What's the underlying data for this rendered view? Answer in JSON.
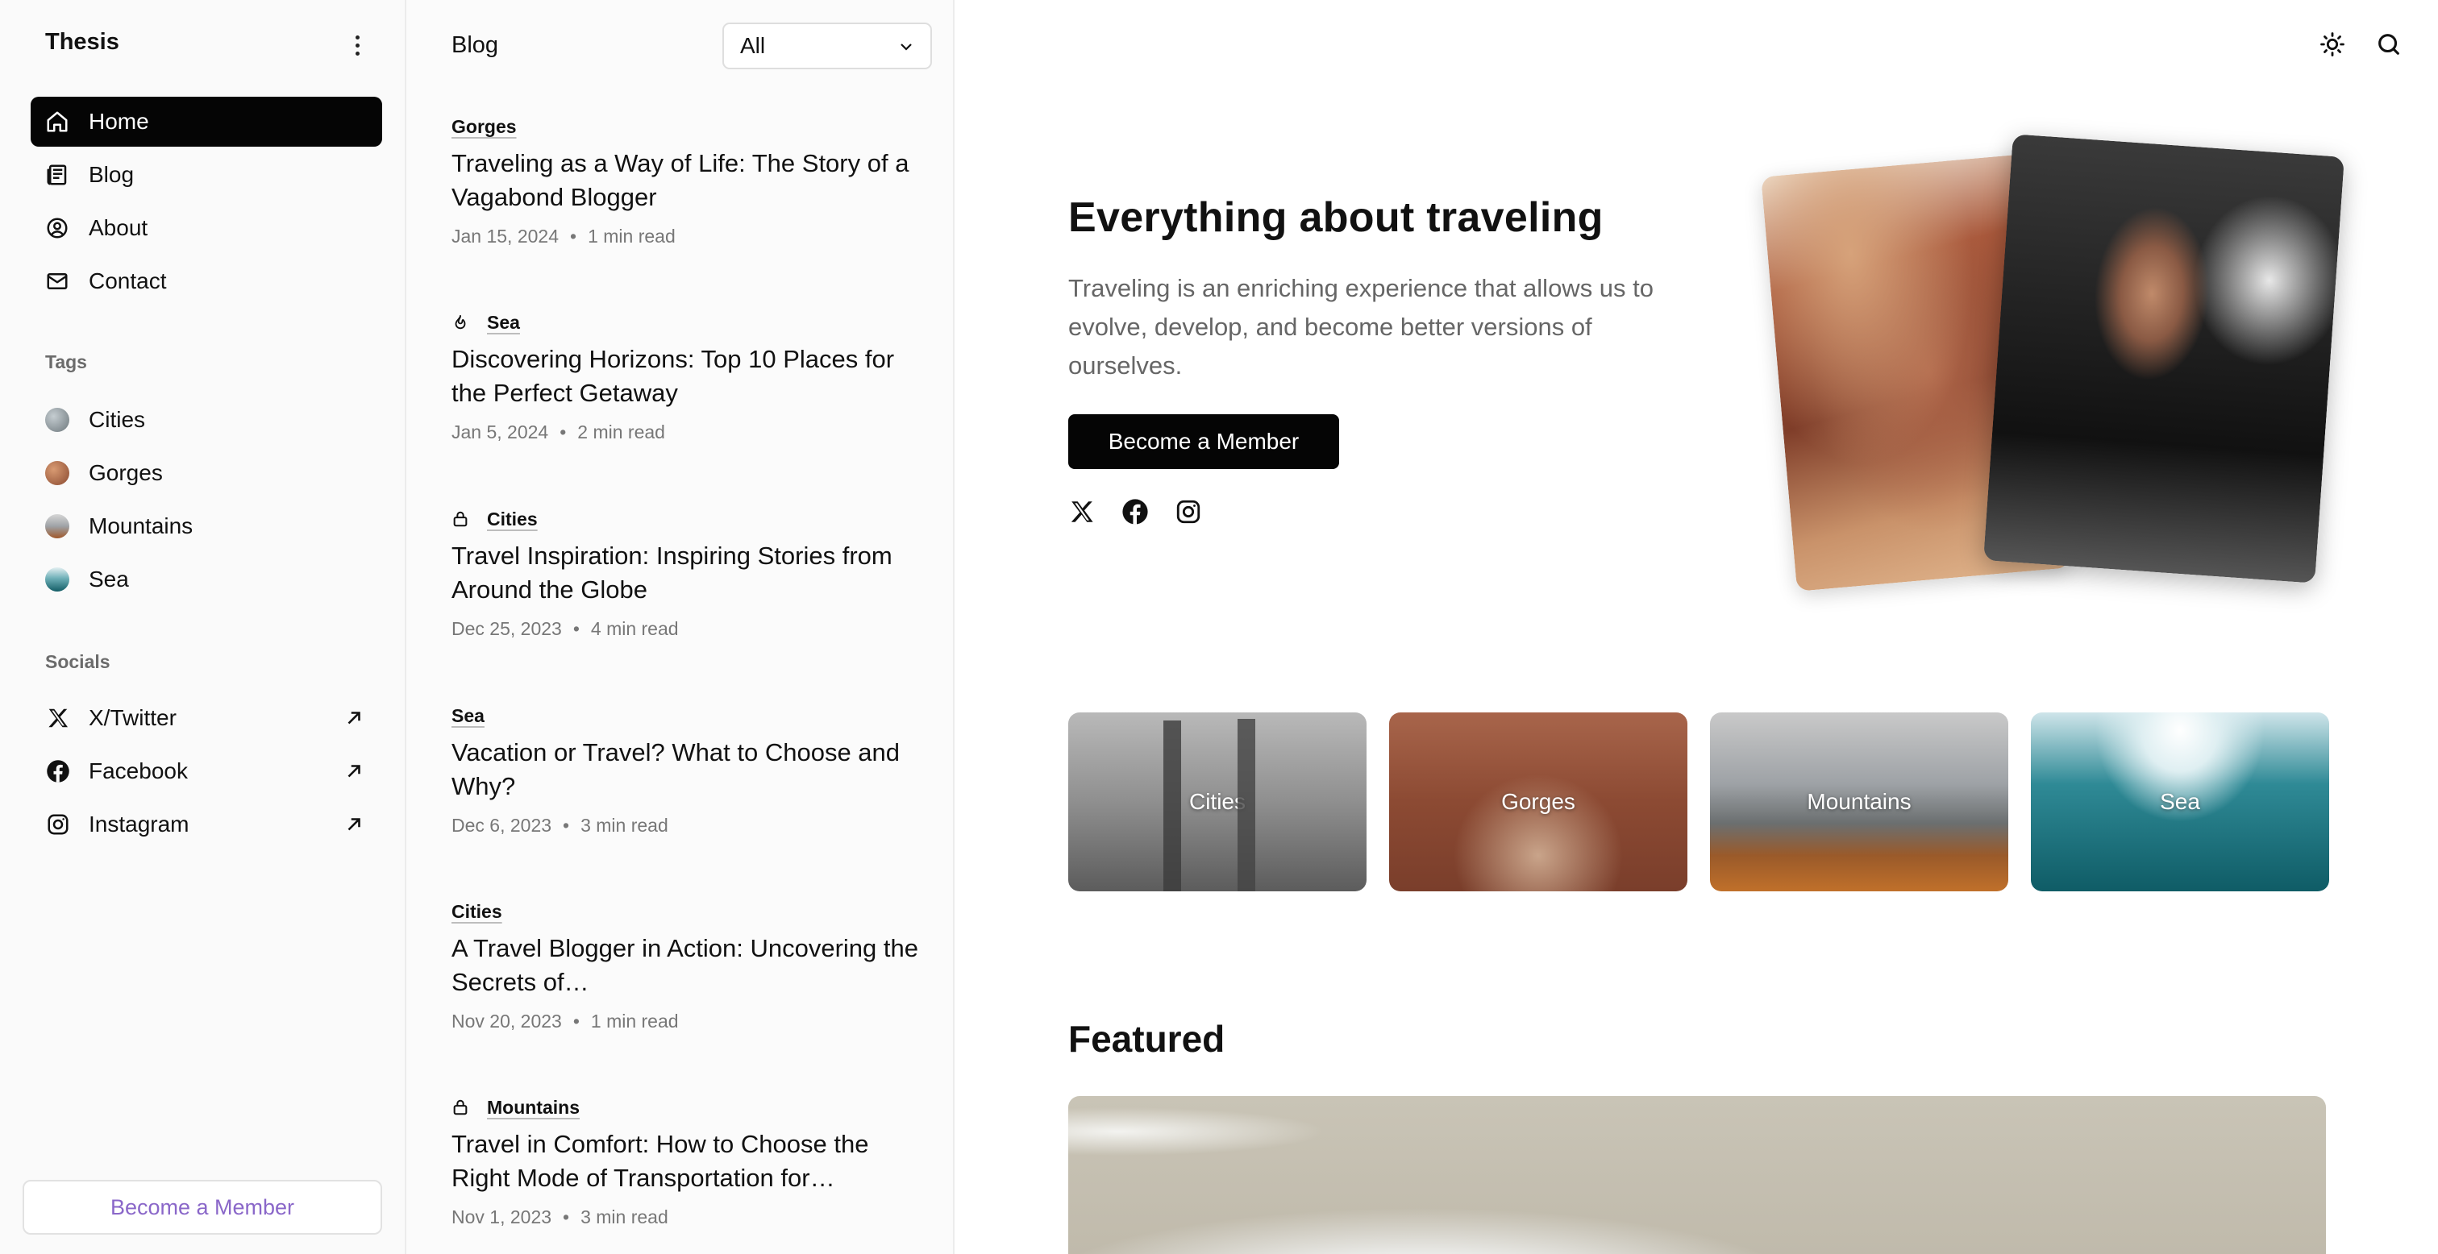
{
  "brand": "Thesis",
  "nav": [
    {
      "label": "Home",
      "icon": "home-icon",
      "active": true
    },
    {
      "label": "Blog",
      "icon": "newspaper-icon",
      "active": false
    },
    {
      "label": "About",
      "icon": "user-circle-icon",
      "active": false
    },
    {
      "label": "Contact",
      "icon": "mail-icon",
      "active": false
    }
  ],
  "tags_section": {
    "title": "Tags",
    "items": [
      {
        "label": "Cities",
        "color": "#8a9296"
      },
      {
        "label": "Gorges",
        "color": "#a5603f"
      },
      {
        "label": "Mountains",
        "color": "#7d6a5c"
      },
      {
        "label": "Sea",
        "color": "#2b7882"
      }
    ]
  },
  "socials_section": {
    "title": "Socials",
    "items": [
      {
        "label": "X/Twitter",
        "icon": "x-twitter-icon"
      },
      {
        "label": "Facebook",
        "icon": "facebook-icon"
      },
      {
        "label": "Instagram",
        "icon": "instagram-icon"
      }
    ]
  },
  "sidebar_cta": "Become a Member",
  "bloglist": {
    "title": "Blog",
    "filter_value": "All",
    "posts": [
      {
        "tag": "Gorges",
        "tag_icon": "",
        "title": "Traveling as a Way of Life: The Story of a Vagabond Blogger",
        "date": "Jan 15, 2024",
        "read": "1 min read"
      },
      {
        "tag": "Sea",
        "tag_icon": "flame-icon",
        "title": "Discovering Horizons: Top 10 Places for the Perfect Getaway",
        "date": "Jan 5, 2024",
        "read": "2 min read"
      },
      {
        "tag": "Cities",
        "tag_icon": "lock-icon",
        "title": "Travel Inspiration: Inspiring Stories from Around the Globe",
        "date": "Dec 25, 2023",
        "read": "4 min read"
      },
      {
        "tag": "Sea",
        "tag_icon": "",
        "title": "Vacation or Travel? What to Choose and Why?",
        "date": "Dec 6, 2023",
        "read": "3 min read"
      },
      {
        "tag": "Cities",
        "tag_icon": "",
        "title": "A Travel Blogger in Action: Uncovering the Secrets of…",
        "date": "Nov 20, 2023",
        "read": "1 min read"
      },
      {
        "tag": "Mountains",
        "tag_icon": "lock-icon",
        "title": "Travel in Comfort: How to Choose the Right Mode of Transportation for…",
        "date": "Nov 1, 2023",
        "read": "3 min read"
      }
    ]
  },
  "hero": {
    "title": "Everything about traveling",
    "description": "Traveling is an enriching experience that allows us to evolve, develop, and become better versions of ourselves.",
    "cta": "Become a Member"
  },
  "tag_cards": [
    "Cities",
    "Gorges",
    "Mountains",
    "Sea"
  ],
  "featured_title": "Featured"
}
